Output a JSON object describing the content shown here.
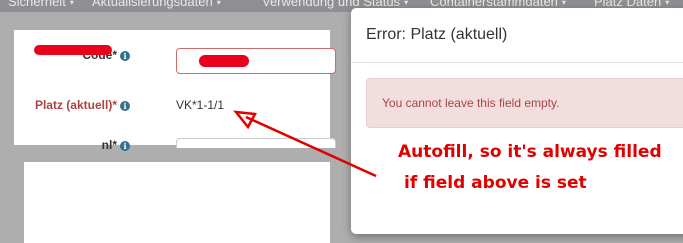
{
  "navbar": {
    "items": [
      {
        "label": "Sicherheit",
        "caret": "▾"
      },
      {
        "label": "Aktualisierungsdaten",
        "caret": "▾"
      },
      {
        "label": "Verwendung und Status",
        "caret": "▾"
      },
      {
        "label": "Containerstammdaten",
        "caret": "▾"
      },
      {
        "label": "Platz Daten",
        "caret": "▾"
      }
    ]
  },
  "form": {
    "row1_label": "Code*",
    "row2_label": "Platz (aktuell)*",
    "row2_value": "VK*1-1/1",
    "row3_label": "nl*",
    "info_icon": "i"
  },
  "modal": {
    "title": "Error: Platz (aktuell)",
    "message": "You cannot leave this field empty."
  },
  "annotation": {
    "line1": "Autofill, so it's always filled",
    "line2": "if field above is set",
    "color": "#e00000"
  }
}
